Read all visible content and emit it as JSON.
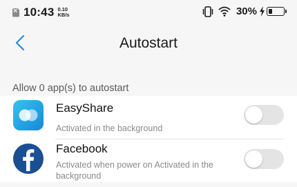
{
  "status_bar": {
    "time": "10:43",
    "net_speed_value": "0.10",
    "net_speed_unit": "KB/s",
    "battery_percent": "30%",
    "battery_level": 0.3,
    "icons": [
      "sim-absent-icon",
      "vibrate-icon",
      "wifi-icon",
      "charging-bolt-icon",
      "battery-icon"
    ]
  },
  "header": {
    "title": "Autostart",
    "back_icon": "chevron-left-icon"
  },
  "section": {
    "label": "Allow 0 app(s) to autostart"
  },
  "apps": [
    {
      "name": "EasyShare",
      "subtitle": "Activated in the background",
      "enabled": false,
      "icon": "easyshare-app-icon"
    },
    {
      "name": "Facebook",
      "subtitle": "Activated when power on  Activated in the background",
      "enabled": false,
      "icon": "facebook-app-icon"
    }
  ],
  "colors": {
    "accent": "#2a8be0",
    "background": "#f6f6f6",
    "toggle_off": "#e4e4e4",
    "easyshare": "#1fa7e6",
    "facebook": "#1b4f93"
  }
}
